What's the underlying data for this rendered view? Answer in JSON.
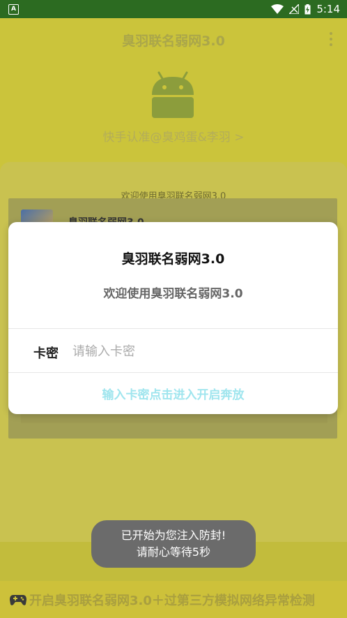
{
  "status_bar": {
    "app_badge": "A",
    "time": "5:14",
    "icons": [
      "wifi-icon",
      "signal-icon",
      "battery-charging-icon"
    ]
  },
  "app_bar": {
    "title": "臭羽联名弱网3.0",
    "menu_icon": "overflow-menu-icon"
  },
  "header": {
    "logo_icon": "android-robot-icon",
    "author_link": "快手认准@臭鸡蛋&李羽 >"
  },
  "card": {
    "welcome": "欢迎使用臭羽联名弱网3.0",
    "item_title": "臭羽联名弱网3.0"
  },
  "dialog": {
    "title": "臭羽联名弱网3.0",
    "message": "欢迎使用臭羽联名弱网3.0",
    "field_label": "卡密",
    "field_placeholder": "请输入卡密",
    "field_value": "",
    "confirm_label": "输入卡密点击进入开启奔放"
  },
  "marquee": {
    "icon": "gamepad-icon",
    "text": "开启臭羽联名弱网3.0＋过第三方模拟网络异常检测"
  },
  "toast": {
    "line1": "已开始为您注入防封!",
    "line2": "请耐心等待5秒"
  },
  "colors": {
    "status_bar": "#2c6b21",
    "scrim_background": "#cbc43b",
    "confirm_text": "#9fe5ee",
    "toast_bg": "#6b6b6b"
  }
}
